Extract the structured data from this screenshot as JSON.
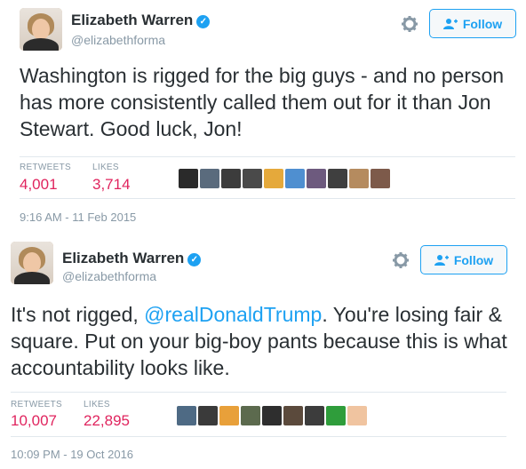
{
  "tweets": [
    {
      "name": "Elizabeth Warren",
      "handle": "@elizabethforma",
      "follow_label": "Follow",
      "text": "Washington is rigged for the big guys - and no person has more consistently called them out for it than Jon Stewart. Good luck, Jon!",
      "retweets_label": "RETWEETS",
      "retweets": "4,001",
      "likes_label": "LIKES",
      "likes": "3,714",
      "timestamp": "9:16 AM - 11 Feb 2015",
      "liker_colors": [
        "#2a2a2a",
        "#5a6b7d",
        "#3c3c3c",
        "#4a4a4a",
        "#e5a93b",
        "#4f8fd0",
        "#6d5a7e",
        "#3f3f3f",
        "#b58b5f",
        "#7d5a4a"
      ]
    },
    {
      "name": "Elizabeth Warren",
      "handle": "@elizabethforma",
      "follow_label": "Follow",
      "text_before": "It's not rigged, ",
      "mention": "@realDonaldTrump",
      "text_after": ". You're losing fair & square. Put on your big-boy pants because this is what accountability looks like.",
      "retweets_label": "RETWEETS",
      "retweets": "10,007",
      "likes_label": "LIKES",
      "likes": "22,895",
      "timestamp": "10:09 PM - 19 Oct 2016",
      "liker_colors": [
        "#4e6a84",
        "#3a3a3a",
        "#e8a03a",
        "#5c6a4e",
        "#2e2e2e",
        "#5b4a3c",
        "#3c3c3c",
        "#2f9d3b",
        "#f0c4a0"
      ]
    }
  ]
}
